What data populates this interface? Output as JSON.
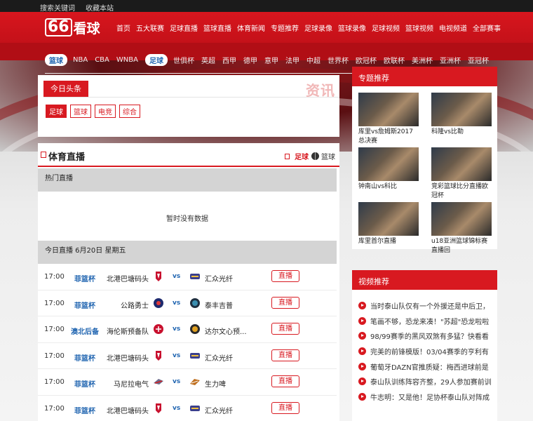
{
  "topbar": {
    "search": "搜索关键词",
    "favorite": "收藏本站"
  },
  "logo": {
    "num": "66",
    "text": "看球"
  },
  "nav": [
    "首页",
    "五大联赛",
    "足球直播",
    "篮球直播",
    "体育新闻",
    "专题推荐",
    "足球录像",
    "篮球录像",
    "足球视频",
    "篮球视频",
    "电视频道",
    "全部赛事"
  ],
  "subnav": {
    "basketball_pill": "篮球",
    "basketball_links": [
      "NBA",
      "CBA",
      "WNBA"
    ],
    "football_pill": "足球",
    "football_links": [
      "世俱杯",
      "英超",
      "西甲",
      "德甲",
      "意甲",
      "法甲",
      "中超",
      "世界杯",
      "欧冠杯",
      "欧联杯",
      "美洲杯",
      "亚洲杯",
      "亚冠杯"
    ]
  },
  "news": {
    "tab": "今日头条",
    "watermark": "资讯",
    "cats": [
      "足球",
      "篮球",
      "电竞",
      "综合"
    ]
  },
  "live": {
    "title": "体育直播",
    "filter_football": "足球",
    "filter_basketball": "篮球",
    "hot_title": "热门直播",
    "empty": "暂时没有数据",
    "today_title": "今日直播 6月20日 星期五",
    "btn": "直播",
    "vs": "vs",
    "matches": [
      {
        "time": "17:00",
        "league": "菲篮杯",
        "home": "北港巴塘码头",
        "away": "汇众光纤"
      },
      {
        "time": "17:00",
        "league": "菲篮杯",
        "home": "公路勇士",
        "away": "泰丰吉普"
      },
      {
        "time": "17:00",
        "league": "澳北后备",
        "home": "海伦斯预备队",
        "away": "达尔文心预..."
      },
      {
        "time": "17:00",
        "league": "菲篮杯",
        "home": "北港巴塘码头",
        "away": "汇众光纤"
      },
      {
        "time": "17:00",
        "league": "菲篮杯",
        "home": "马尼拉电气",
        "away": "生力啤"
      },
      {
        "time": "17:00",
        "league": "菲篮杯",
        "home": "北港巴塘码头",
        "away": "汇众光纤"
      }
    ]
  },
  "topics": {
    "title": "专题推荐",
    "items": [
      "库里vs詹姆斯2017总决赛",
      "科隆vs比勒",
      "钟南山vs科比",
      "竞彩篮球比分直播欧冠杯",
      "库里首尔直播",
      "u18亚洲篮球锦标赛直播回"
    ]
  },
  "videos": {
    "title": "视频推荐",
    "items": [
      "当时泰山队仅有一个外援还是中后卫，",
      "笔画不够，恐龙来凑！\"苏超\"恐龙啦啦",
      "98/99赛季的黑风双煞有多猛？快看看",
      "完美的前锋模版！03/04赛季的亨利有",
      "葡萄牙DAZN官推质疑：梅西进球前是",
      "泰山队训练阵容齐整，29人参加赛前训",
      "牛志明：又是他！足协杯泰山队对阵成"
    ]
  }
}
